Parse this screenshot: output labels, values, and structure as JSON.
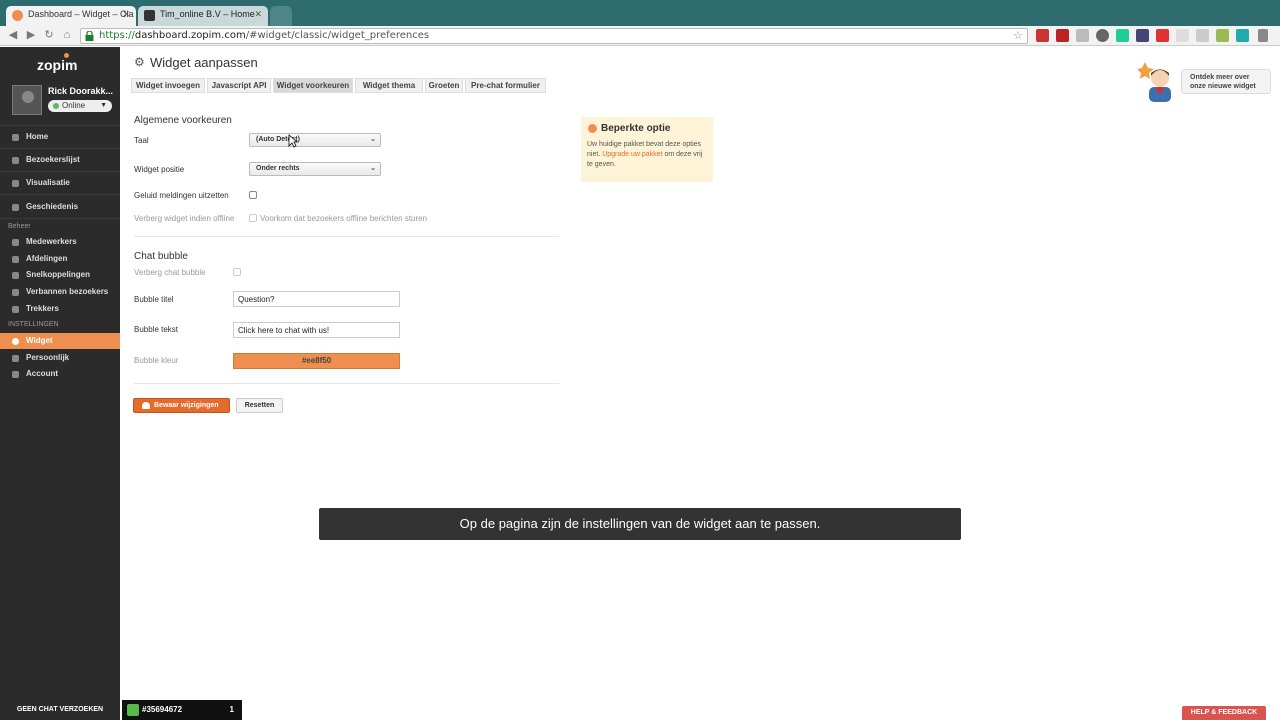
{
  "browser": {
    "tabs": [
      {
        "title": "Dashboard – Widget – Cla",
        "active": true
      },
      {
        "title": "Tim_online B.V – Home",
        "active": false
      }
    ],
    "url_scheme": "https://",
    "url_domain": "dashboard.zopim.com",
    "url_path": "/#widget/classic/widget_preferences"
  },
  "sidebar": {
    "logo": "zopim",
    "user_name": "Rick Doorakk...",
    "status": "Online",
    "items": [
      {
        "label": "Home"
      },
      {
        "label": "Bezoekerslijst"
      },
      {
        "label": "Visualisatie"
      },
      {
        "label": "Geschiedenis"
      }
    ],
    "beheer_label": "Beheer",
    "beheer_items": [
      {
        "label": "Medewerkers"
      },
      {
        "label": "Afdelingen"
      },
      {
        "label": "Snelkoppelingen"
      },
      {
        "label": "Verbannen bezoekers"
      },
      {
        "label": "Trekkers"
      }
    ],
    "instellingen_label": "INSTELLINGEN",
    "instellingen_items": [
      {
        "label": "Widget"
      },
      {
        "label": "Persoonlijk"
      },
      {
        "label": "Account"
      }
    ]
  },
  "bottom": {
    "no_chat": "GEEN CHAT VERZOEKEN",
    "visitor_id": "#35694672",
    "visitor_count": "1",
    "help": "HELP & FEEDBACK"
  },
  "page": {
    "title": "Widget aanpassen",
    "tabs": [
      "Widget invoegen",
      "Javascript API",
      "Widget voorkeuren",
      "Widget thema",
      "Groeten",
      "Pre-chat formulier"
    ],
    "promo": "Ontdek meer over onze nieuwe widget"
  },
  "general": {
    "heading": "Algemene voorkeuren",
    "taal_label": "Taal",
    "taal_value": "(Auto Detect)",
    "positie_label": "Widget positie",
    "positie_value": "Onder rechts",
    "geluid_label": "Geluid meldingen uitzetten",
    "offline_label": "Verberg widget indien offline",
    "offline_text": "Voorkom dat bezoekers offline berichten sturen"
  },
  "bubble": {
    "heading": "Chat bubble",
    "hide_label": "Verberg chat bubble",
    "title_label": "Bubble titel",
    "title_value": "Question?",
    "text_label": "Bubble tekst",
    "text_value": "Click here to chat with us!",
    "color_label": "Bubble kleur",
    "color_value": "#ee8f50"
  },
  "actions": {
    "save": "Bewaar wijzigingen",
    "reset": "Resetten"
  },
  "limit": {
    "title": "Beperkte optie",
    "text_before": "Uw huidige pakket bevat deze opties niet.",
    "link": "Upgrade uw pakket",
    "text_after": "om deze vrij te geven."
  },
  "subtitle": "Op de pagina zijn de instellingen van de widget aan te passen.",
  "colors": {
    "accent": "#ee8f50",
    "sidebar": "#2b2b2b",
    "chrome": "#2d6b6e"
  }
}
